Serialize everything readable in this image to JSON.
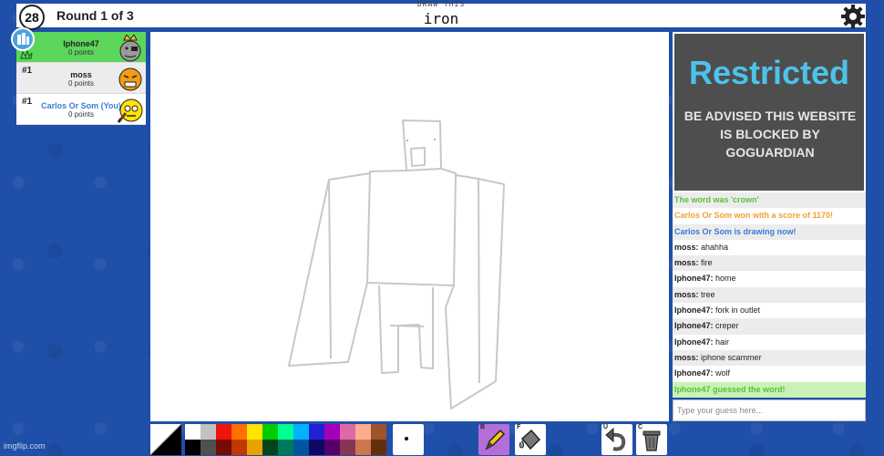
{
  "header": {
    "timer": "28",
    "round": "Round 1 of 3",
    "draw_hint": "DRAW THIS",
    "word": "iron"
  },
  "players": [
    {
      "rank": "",
      "name": "Iphone47",
      "points": "0 points"
    },
    {
      "rank": "#1",
      "name": "moss",
      "points": "0 points"
    },
    {
      "rank": "#1",
      "name": "Carlos Or Som (You)",
      "points": "0 points"
    }
  ],
  "ad": {
    "title": "Restricted",
    "body": "BE ADVISED THIS WEBSITE IS BLOCKED BY GOGUARDIAN"
  },
  "chat": [
    {
      "who": "",
      "text": "The word was 'crown'",
      "color": "#5bbf3a"
    },
    {
      "who": "",
      "text": "Carlos Or Som won with a score of 1170!",
      "color": "#f0a030"
    },
    {
      "who": "",
      "text": "Carlos Or Som is drawing now!",
      "color": "#3a7bd5"
    },
    {
      "who": "moss:",
      "text": "ahahha",
      "color": "#222"
    },
    {
      "who": "moss:",
      "text": "fire",
      "color": "#222"
    },
    {
      "who": "Iphone47:",
      "text": "home",
      "color": "#222"
    },
    {
      "who": "moss:",
      "text": "tree",
      "color": "#222"
    },
    {
      "who": "Iphone47:",
      "text": "fork in outlet",
      "color": "#222"
    },
    {
      "who": "Iphone47:",
      "text": "creper",
      "color": "#222"
    },
    {
      "who": "Iphone47:",
      "text": "hair",
      "color": "#222"
    },
    {
      "who": "moss:",
      "text": "iphone scammer",
      "color": "#222"
    },
    {
      "who": "Iphone47:",
      "text": "wolf",
      "color": "#222"
    },
    {
      "who": "",
      "text": "Iphone47 guessed the word!",
      "color": "#5bbf3a"
    }
  ],
  "chat_input": {
    "placeholder": "Type your guess here..."
  },
  "palette_top": [
    "#ffffff",
    "#c1c1c1",
    "#ef130b",
    "#ff7100",
    "#ffe400",
    "#00cc00",
    "#00ff91",
    "#00b2ff",
    "#231fd3",
    "#a300ba",
    "#df69a7",
    "#ffac8e",
    "#a0522d"
  ],
  "palette_bottom": [
    "#000000",
    "#505050",
    "#740b07",
    "#c23800",
    "#e8a200",
    "#004619",
    "#00785d",
    "#00569e",
    "#0e0865",
    "#550069",
    "#873554",
    "#cc774d",
    "#63300d"
  ],
  "tool_keys": {
    "brush": "B",
    "fill": "F",
    "undo": "U",
    "clear": "C"
  },
  "watermark": "imgflip.com"
}
